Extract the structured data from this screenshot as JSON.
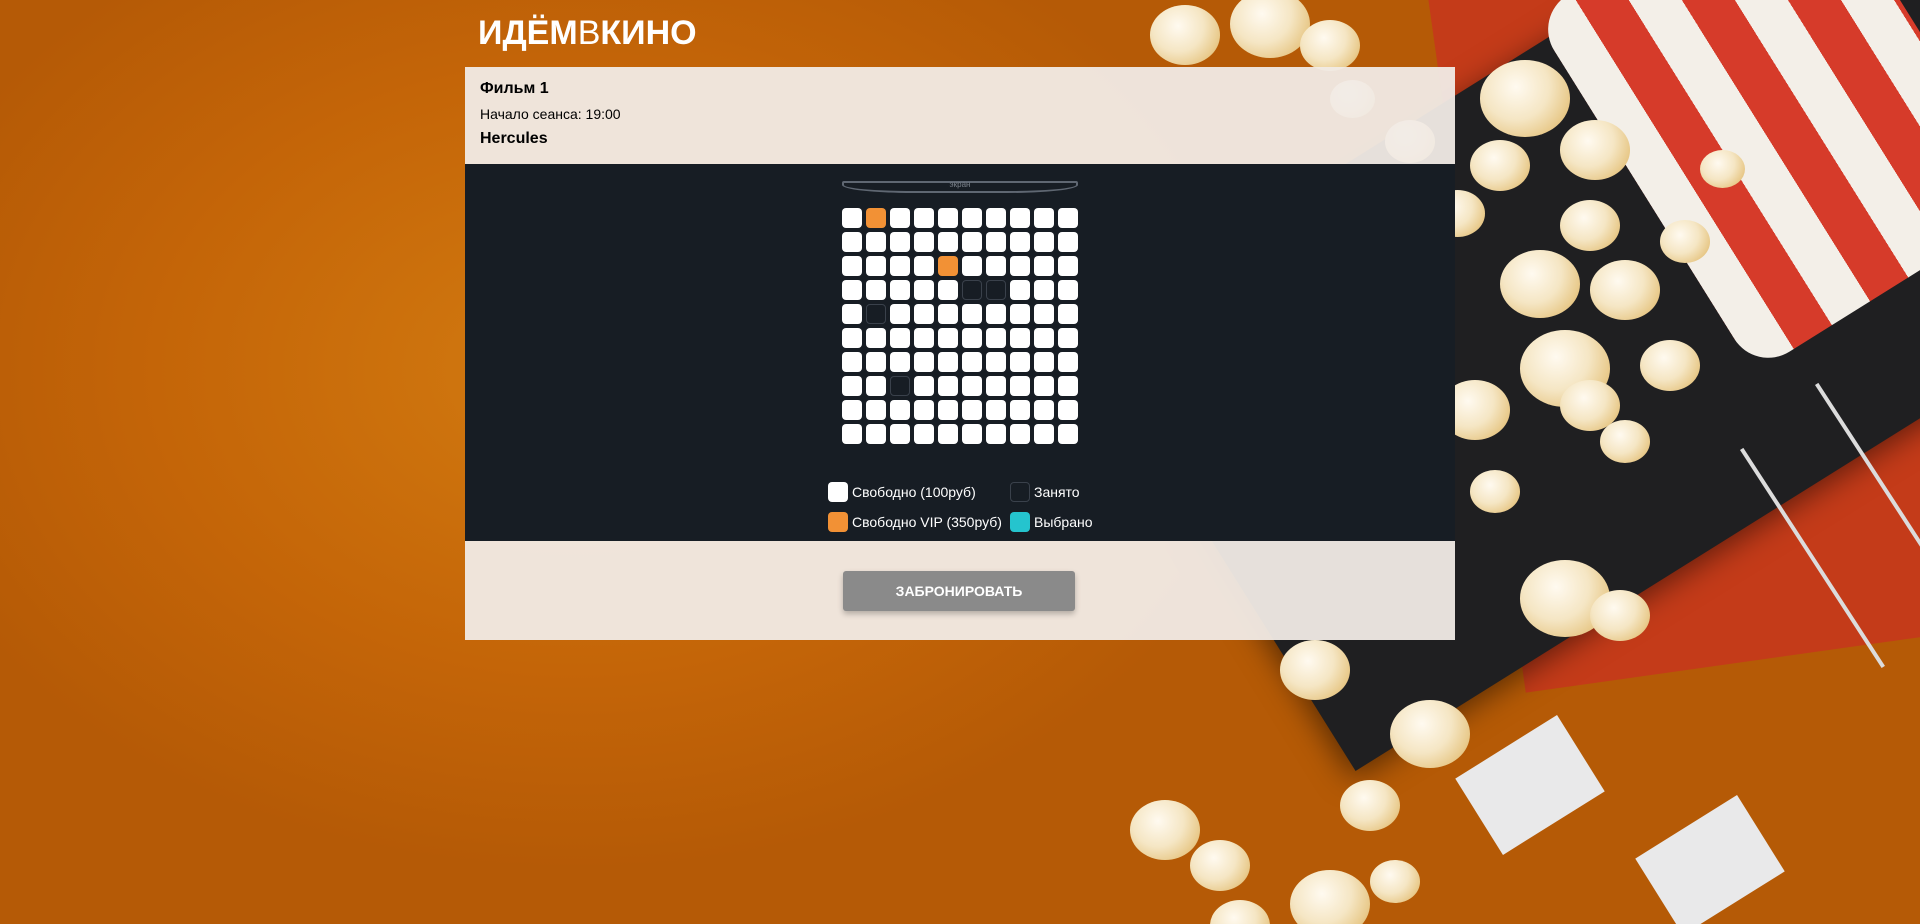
{
  "logo": {
    "part1": "ИДЁМ",
    "part2": "В",
    "part3": "КИНО"
  },
  "film": {
    "title": "Фильм 1",
    "session_start": "Начало сеанса: 19:00",
    "hall": "Hercules"
  },
  "screen_label": "экран",
  "seat_map": {
    "rows": 10,
    "cols": 10,
    "legend_types": [
      "free",
      "taken",
      "vip",
      "selected"
    ],
    "grid": [
      [
        "free",
        "vip",
        "free",
        "free",
        "free",
        "free",
        "free",
        "free",
        "free",
        "free"
      ],
      [
        "free",
        "free",
        "free",
        "free",
        "free",
        "free",
        "free",
        "free",
        "free",
        "free"
      ],
      [
        "free",
        "free",
        "free",
        "free",
        "vip",
        "free",
        "free",
        "free",
        "free",
        "free"
      ],
      [
        "free",
        "free",
        "free",
        "free",
        "free",
        "taken",
        "taken",
        "free",
        "free",
        "free"
      ],
      [
        "free",
        "taken",
        "free",
        "free",
        "free",
        "free",
        "free",
        "free",
        "free",
        "free"
      ],
      [
        "free",
        "free",
        "free",
        "free",
        "free",
        "free",
        "free",
        "free",
        "free",
        "free"
      ],
      [
        "free",
        "free",
        "free",
        "free",
        "free",
        "free",
        "free",
        "free",
        "free",
        "free"
      ],
      [
        "free",
        "free",
        "taken",
        "free",
        "free",
        "free",
        "free",
        "free",
        "free",
        "free"
      ],
      [
        "free",
        "free",
        "free",
        "free",
        "free",
        "free",
        "free",
        "free",
        "free",
        "free"
      ],
      [
        "free",
        "free",
        "free",
        "free",
        "free",
        "free",
        "free",
        "free",
        "free",
        "free"
      ]
    ]
  },
  "legend": {
    "free": "Свободно (100руб)",
    "taken": "Занято",
    "vip": "Свободно VIP (350руб)",
    "selected": "Выбрано"
  },
  "colors": {
    "free": "#ffffff",
    "vip": "#f29135",
    "taken": "#171d24",
    "selected": "#25c4ce",
    "hall_bg": "#171d24",
    "button": "#8a8a8a"
  },
  "book_button": "ЗАБРОНИРОВАТЬ"
}
